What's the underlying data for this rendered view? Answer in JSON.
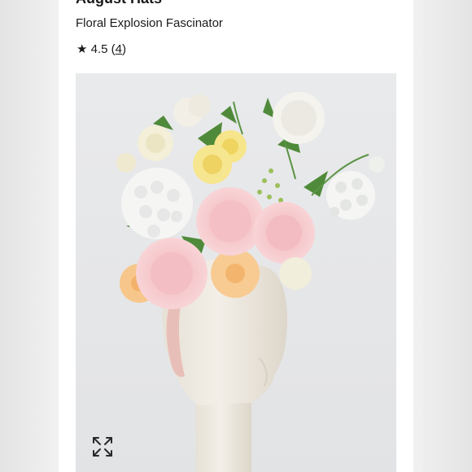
{
  "product": {
    "brand": "August Hats",
    "name": "Floral Explosion Fascinator",
    "rating": {
      "star": "★",
      "value": "4.5",
      "count_open": "(",
      "count": "4",
      "count_close": ")"
    }
  },
  "image": {
    "expand_icon": "expand-arrows-icon"
  },
  "colors": {
    "page_bg": "#ececec",
    "card_bg": "#ffffff",
    "text": "#1a1a1a",
    "photo_bg": "#e7e8ea"
  }
}
